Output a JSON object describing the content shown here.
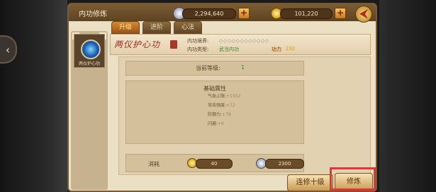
{
  "window": {
    "title": "内功修炼"
  },
  "resources": {
    "gems": "2,294,640",
    "coins": "101,220",
    "plus": "+"
  },
  "tabs": [
    {
      "label": "升级",
      "active": true
    },
    {
      "label": "进阶",
      "active": false
    },
    {
      "label": "心法",
      "active": false
    }
  ],
  "skill": {
    "name": "两仪护心功",
    "avatar_caption": "两仪护心功",
    "realm_label": "内功境界:",
    "realm_value": "◇◇◇◇◇◇◇◇◇◇◇◇",
    "type_label": "内功类型:",
    "type_value": "武当内功",
    "power_label": "功力",
    "power_value": "232"
  },
  "level": {
    "label": "当前等级:",
    "value": "1"
  },
  "attributes": {
    "title": "基础属性",
    "items": [
      {
        "name": "气血上限:",
        "value": "+1552"
      },
      {
        "name": "攻击强度:",
        "value": "+72"
      },
      {
        "name": "防御力:",
        "value": "+78"
      },
      {
        "name": "闪避:",
        "value": "+0"
      }
    ]
  },
  "cost": {
    "label": "消耗",
    "coins": "40",
    "gems": "2300"
  },
  "buttons": {
    "upgrade_ten": "连修十级",
    "train": "修炼"
  },
  "colors": {
    "accent_orange": "#d98a2e",
    "panel": "#ece0c4",
    "highlight": "#e4343a",
    "green_value": "#2f8a2f"
  },
  "icons": {
    "gem": "gem-icon",
    "coin": "coin-icon",
    "back": "back-arrow-icon",
    "plus": "plus-icon"
  }
}
